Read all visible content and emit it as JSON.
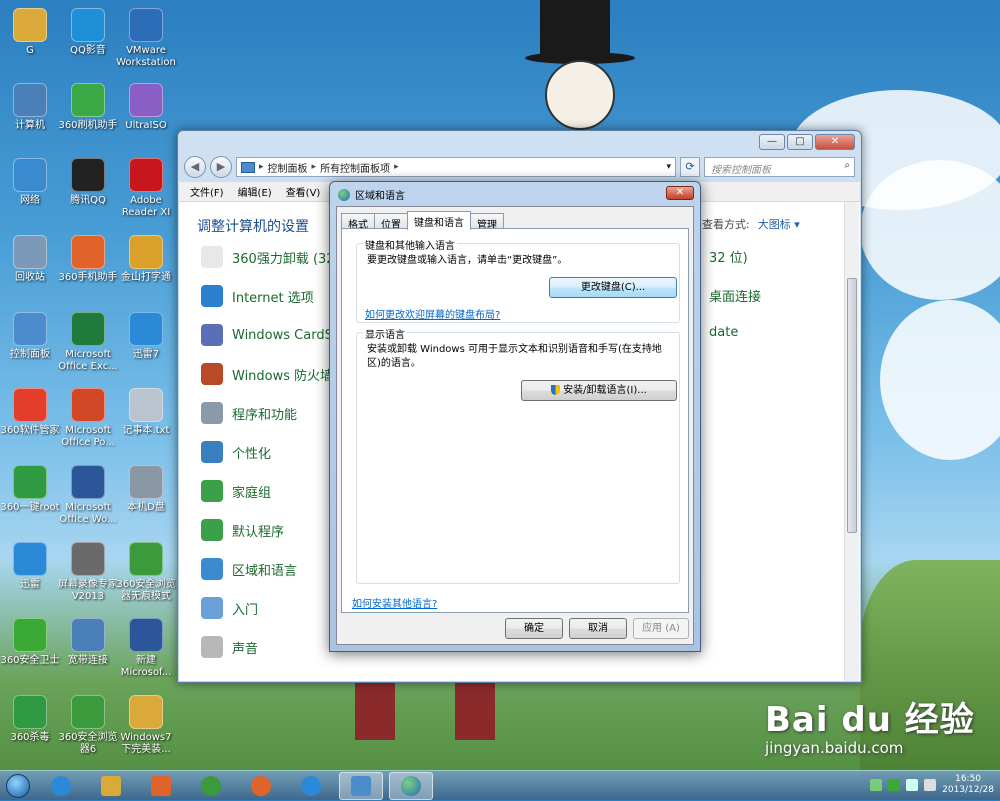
{
  "desktop_icons": [
    {
      "label": "G",
      "icon": "folder-icon",
      "color": "#d9a93a"
    },
    {
      "label": "QQ影音",
      "icon": "qq-player-icon",
      "color": "#1f8fd8"
    },
    {
      "label": "VMware Workstation",
      "icon": "vmware-icon",
      "color": "#2c6db8"
    },
    {
      "label": "计算机",
      "icon": "computer-icon",
      "color": "#4a7fb8"
    },
    {
      "label": "360刷机助手",
      "icon": "360-flash-icon",
      "color": "#39a845"
    },
    {
      "label": "UltraISO",
      "icon": "ultraiso-icon",
      "color": "#8a5ec4"
    },
    {
      "label": "网络",
      "icon": "network-icon",
      "color": "#3a8ad0"
    },
    {
      "label": "腾讯QQ",
      "icon": "qq-icon",
      "color": "#222222"
    },
    {
      "label": "Adobe Reader XI",
      "icon": "adobe-reader-icon",
      "color": "#c8161d"
    },
    {
      "label": "回收站",
      "icon": "recycle-bin-icon",
      "color": "#7c9ab8"
    },
    {
      "label": "360手机助手",
      "icon": "360-phone-icon",
      "color": "#e0632c"
    },
    {
      "label": "金山打字通",
      "icon": "typing-icon",
      "color": "#d9a12a"
    },
    {
      "label": "控制面板",
      "icon": "control-panel-icon",
      "color": "#4d8ccc"
    },
    {
      "label": "Microsoft Office Exc...",
      "icon": "excel-icon",
      "color": "#1e7b3c"
    },
    {
      "label": "迅雷7",
      "icon": "thunder-icon",
      "color": "#2a8ad8"
    },
    {
      "label": "360软件管家",
      "icon": "360-software-icon",
      "color": "#e33e2c"
    },
    {
      "label": "Microsoft Office Po...",
      "icon": "powerpoint-icon",
      "color": "#d24726"
    },
    {
      "label": "记事本.txt",
      "icon": "notepad-icon",
      "color": "#b9c4cf"
    },
    {
      "label": "360一键root",
      "icon": "360-root-icon",
      "color": "#2f9a42"
    },
    {
      "label": "Microsoft Office Wo...",
      "icon": "word-icon",
      "color": "#2b579a"
    },
    {
      "label": "本机D盘",
      "icon": "drive-icon",
      "color": "#8a97a5"
    },
    {
      "label": "迅雷",
      "icon": "thunder-icon",
      "color": "#2a8ad8"
    },
    {
      "label": "屏幕录像专家V2013",
      "icon": "screen-recorder-icon",
      "color": "#6a6a6a"
    },
    {
      "label": "360安全浏览器无痕模式",
      "icon": "360-browser-private-icon",
      "color": "#3b9a3b"
    },
    {
      "label": "360安全卫士",
      "icon": "360-security-icon",
      "color": "#3aaa35"
    },
    {
      "label": "宽带连接",
      "icon": "broadband-icon",
      "color": "#4a7fb8"
    },
    {
      "label": "新建 Microsof...",
      "icon": "word-doc-icon",
      "color": "#2b579a"
    },
    {
      "label": "360杀毒",
      "icon": "360-antivirus-icon",
      "color": "#2f9a42"
    },
    {
      "label": "360安全浏览器6",
      "icon": "360-browser-icon",
      "color": "#3b9a3b"
    },
    {
      "label": "Windows7下完美装...",
      "icon": "folder-icon",
      "color": "#d9a93a"
    }
  ],
  "explorer": {
    "breadcrumb": [
      "控制面板",
      "所有控制面板项"
    ],
    "search_placeholder": "搜索控制面板",
    "menu": [
      "文件(F)",
      "编辑(E)",
      "查看(V)"
    ],
    "title": "调整计算机的设置",
    "view_label": "查看方式:",
    "view_value": "大图标 ▾",
    "items": [
      {
        "label": "360强力卸载 (32",
        "icon": "uninstall-icon",
        "color": "#e8e8e8"
      },
      {
        "label": "Internet 选项",
        "icon": "internet-options-icon",
        "color": "#2a7fd0"
      },
      {
        "label": "Windows CardSp",
        "icon": "cardspace-icon",
        "color": "#5a6fb8"
      },
      {
        "label": "Windows 防火墙",
        "icon": "firewall-icon",
        "color": "#b84a2a"
      },
      {
        "label": "程序和功能",
        "icon": "programs-icon",
        "color": "#8a9aa8"
      },
      {
        "label": "个性化",
        "icon": "personalize-icon",
        "color": "#3a7fc0"
      },
      {
        "label": "家庭组",
        "icon": "homegroup-icon",
        "color": "#3aa04a"
      },
      {
        "label": "默认程序",
        "icon": "default-programs-icon",
        "color": "#3aa04a"
      },
      {
        "label": "区域和语言",
        "icon": "region-language-icon",
        "color": "#3a8ad0"
      },
      {
        "label": "入门",
        "icon": "getting-started-icon",
        "color": "#6aa0d8"
      },
      {
        "label": "声音",
        "icon": "sound-icon",
        "color": "#b8b8b8"
      }
    ],
    "right_fragments": [
      "32 位)",
      "桌面连接",
      "date"
    ]
  },
  "dialog": {
    "title": "区域和语言",
    "close": "✕",
    "tabs": [
      "格式",
      "位置",
      "键盘和语言",
      "管理"
    ],
    "group1_label": "键盘和其他输入语言",
    "group1_text": "要更改键盘或输入语言，请单击“更改键盘”。",
    "change_keyboard": "更改键盘(C)...",
    "link1": "如何更改欢迎屏幕的键盘布局?",
    "group2_label": "显示语言",
    "group2_text": "安装或卸载 Windows 可用于显示文本和识别语音和手写(在支持地区)的语言。",
    "install_language": "安装/卸载语言(I)...",
    "link2": "如何安装其他语言?",
    "ok": "确定",
    "cancel": "取消",
    "apply": "应用 (A)"
  },
  "taskbar": {
    "time": "16:50",
    "date": "2013/12/28"
  },
  "watermark": {
    "brand": "Bai du 经验",
    "url": "jingyan.baidu.com"
  }
}
